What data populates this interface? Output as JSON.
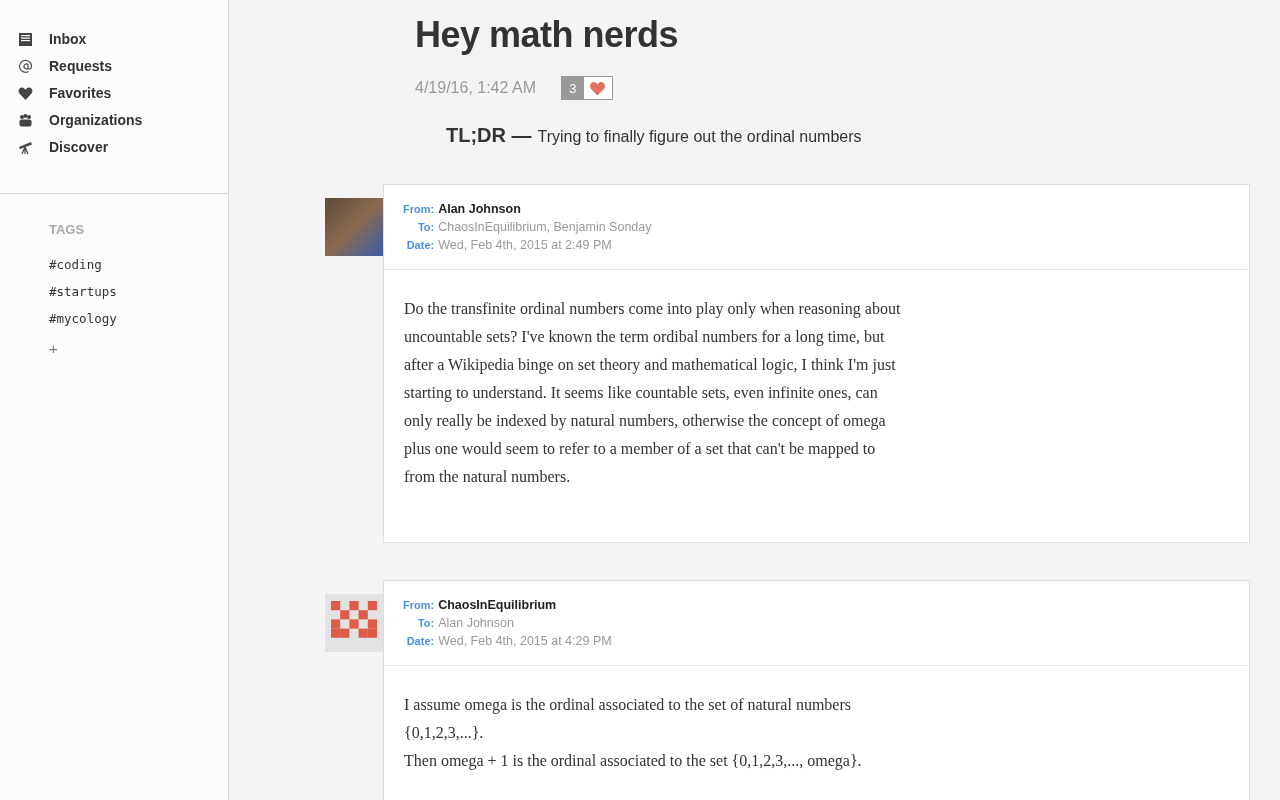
{
  "sidebar": {
    "nav": [
      {
        "kind": "inbox",
        "label": "Inbox"
      },
      {
        "kind": "at",
        "label": "Requests"
      },
      {
        "kind": "heart",
        "label": "Favorites"
      },
      {
        "kind": "people",
        "label": "Organizations"
      },
      {
        "kind": "telescope",
        "label": "Discover"
      }
    ],
    "tags_heading": "TAGS",
    "tags": [
      "#coding",
      "#startups",
      "#mycology"
    ],
    "add_tag": "+"
  },
  "thread": {
    "title": "Hey math nerds",
    "timestamp": "4/19/16, 1:42 AM",
    "likes": {
      "count": "3",
      "liked": true
    },
    "tldr_label": "TL;DR —",
    "tldr": "Trying to finally figure out the ordinal numbers"
  },
  "messages": [
    {
      "avatar": {
        "kind": "photo"
      },
      "from_label": "From:",
      "from": "Alan Johnson",
      "to_label": "To:",
      "to": "ChaosInEquilibrium, Benjamin Sonday",
      "date_label": "Date:",
      "date": "Wed, Feb 4th, 2015 at 2:49 PM",
      "body": [
        "Do the transfinite ordinal numbers come into play only when reasoning about uncountable sets? I've known the term ordibal numbers for a long time, but after a Wikipedia binge on set theory and mathematical logic, I think I'm just starting to understand. It seems like countable sets, even infinite ones, can only really be indexed by natural numbers, otherwise the concept of omega plus one would seem to refer to a member of a set that can't be mapped to from the natural numbers."
      ]
    },
    {
      "avatar": {
        "kind": "identicon"
      },
      "from_label": "From:",
      "from": "ChaosInEquilibrium",
      "to_label": "To:",
      "to": "Alan Johnson",
      "date_label": "Date:",
      "date": "Wed, Feb 4th, 2015 at 4:29 PM",
      "body": [
        "I assume omega is the ordinal associated to the set of natural numbers {0,1,2,3,...}.",
        "Then omega + 1 is the ordinal associated to the set {0,1,2,3,..., omega}."
      ]
    }
  ]
}
